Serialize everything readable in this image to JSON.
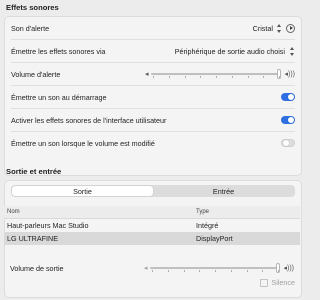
{
  "effets": {
    "title": "Effets sonores",
    "son_alerte_label": "Son d'alerte",
    "son_alerte_value": "Cristal",
    "emettre_via_label": "Émettre les effets sonores via",
    "emettre_via_value": "Périphérique de sortie audio choisi",
    "volume_alerte_label": "Volume d'alerte",
    "volume_alerte_level": 1.0,
    "demarrage_label": "Émettre un son au démarrage",
    "demarrage_on": true,
    "interface_label": "Activer les effets sonores de l'interface utilisateur",
    "interface_on": true,
    "volume_modifie_label": "Émettre un son lorsque le volume est modifié",
    "volume_modifie_on": false
  },
  "sortie_entree": {
    "title": "Sortie et entrée",
    "tabs": [
      "Sortie",
      "Entrée"
    ],
    "active_tab": 0,
    "columns": [
      "Nom",
      "Type"
    ],
    "devices": [
      {
        "name": "Haut-parleurs Mac Studio",
        "type": "Intégré"
      },
      {
        "name": "LG ULTRAFINE",
        "type": "DisplayPort"
      }
    ],
    "selected_index": 1,
    "volume_sortie_label": "Volume de sortie",
    "volume_sortie_level": 1.0,
    "silence_label": "Silence"
  },
  "colors": {
    "accent": "#2f6fe4"
  },
  "icons": {
    "play": "play-circle-icon",
    "stepper": "up-down-chevron-icon",
    "speaker_low": "speaker-low-icon",
    "speaker_high": "speaker-high-icon"
  }
}
